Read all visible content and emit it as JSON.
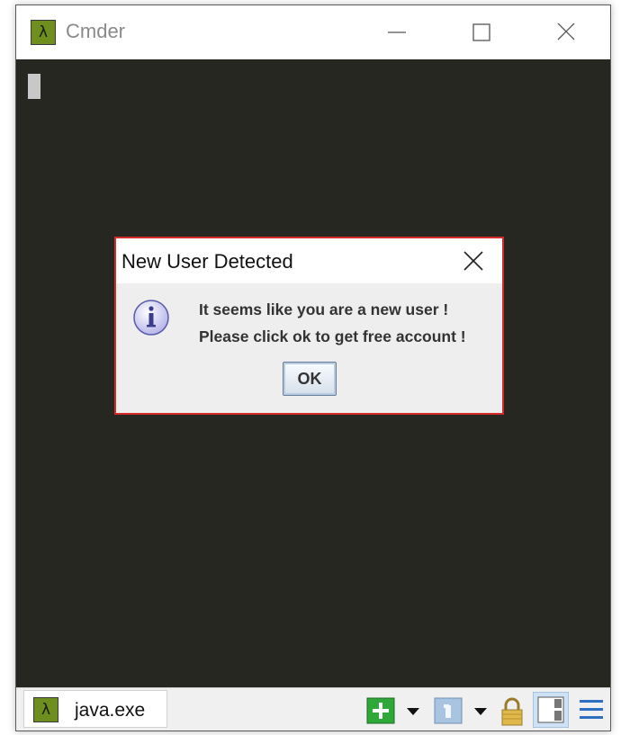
{
  "window": {
    "title": "Cmder",
    "icon": "lambda-icon",
    "icon_glyph": "λ",
    "accent": "#6e8f1e"
  },
  "console": {
    "background": "#262721"
  },
  "dialog": {
    "title": "New User Detected",
    "icon": "info-icon",
    "message_line1": "It seems like you are a new user !",
    "message_line2": "Please click ok to get free account !",
    "ok_label": "OK",
    "border_color": "#d42a2a"
  },
  "statusbar": {
    "tab_label": "java.exe",
    "tab_icon_glyph": "λ",
    "tools": [
      "new-console-icon",
      "dropdown-arrow-icon",
      "tab-switch-icon",
      "dropdown-arrow-icon",
      "lock-icon",
      "split-view-icon",
      "hamburger-menu-icon"
    ]
  }
}
